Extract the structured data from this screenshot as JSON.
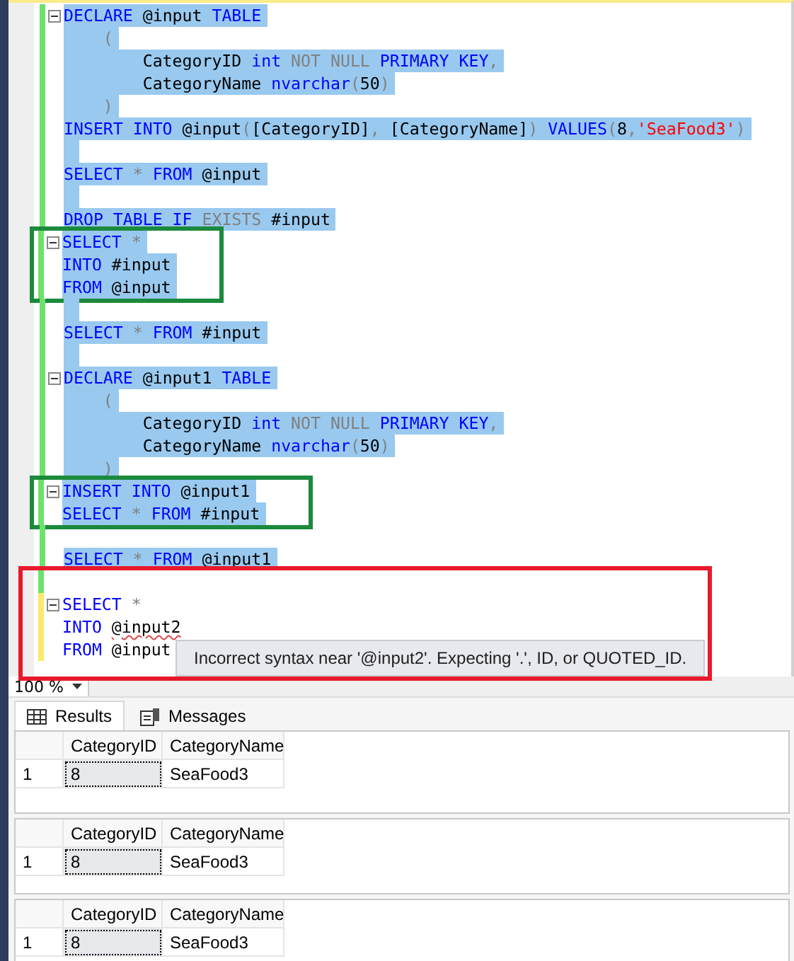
{
  "editor": {
    "blocks": [
      {
        "lines": [
          {
            "selected": true,
            "saved": true,
            "foldable": true,
            "tokens": [
              {
                "kind": "keyword",
                "text": "DECLARE"
              },
              {
                "kind": "plain",
                "text": " @input "
              },
              {
                "kind": "keyword",
                "text": "TABLE"
              }
            ]
          },
          {
            "selected": true,
            "saved": true,
            "foldable": false,
            "tokens": [
              {
                "kind": "operator",
                "text": "    ("
              }
            ]
          },
          {
            "selected": true,
            "saved": true,
            "foldable": false,
            "tokens": [
              {
                "kind": "plain",
                "text": "        CategoryID "
              },
              {
                "kind": "keyword",
                "text": "int"
              },
              {
                "kind": "operator",
                "text": " NOT NULL "
              },
              {
                "kind": "keyword",
                "text": "PRIMARY KEY"
              },
              {
                "kind": "operator",
                "text": ","
              }
            ]
          },
          {
            "selected": true,
            "saved": true,
            "foldable": false,
            "tokens": [
              {
                "kind": "plain",
                "text": "        CategoryName "
              },
              {
                "kind": "keyword",
                "text": "nvarchar"
              },
              {
                "kind": "operator",
                "text": "("
              },
              {
                "kind": "plain",
                "text": "50"
              },
              {
                "kind": "operator",
                "text": ")"
              }
            ]
          },
          {
            "selected": true,
            "saved": true,
            "foldable": false,
            "tokens": [
              {
                "kind": "operator",
                "text": "    )"
              }
            ]
          },
          {
            "selected": true,
            "saved": true,
            "foldable": false,
            "tokens": [
              {
                "kind": "keyword",
                "text": "INSERT INTO"
              },
              {
                "kind": "plain",
                "text": " @input"
              },
              {
                "kind": "operator",
                "text": "("
              },
              {
                "kind": "plain",
                "text": "[CategoryID]"
              },
              {
                "kind": "operator",
                "text": ", "
              },
              {
                "kind": "plain",
                "text": "[CategoryName]"
              },
              {
                "kind": "operator",
                "text": ") "
              },
              {
                "kind": "keyword",
                "text": "VALUES"
              },
              {
                "kind": "operator",
                "text": "("
              },
              {
                "kind": "plain",
                "text": "8"
              },
              {
                "kind": "operator",
                "text": ","
              },
              {
                "kind": "string",
                "text": "'SeaFood3'"
              },
              {
                "kind": "operator",
                "text": ")"
              }
            ]
          },
          {
            "selected": true,
            "saved": true,
            "foldable": false
          },
          {
            "selected": true,
            "saved": true,
            "foldable": false,
            "tokens": [
              {
                "kind": "keyword",
                "text": "SELECT"
              },
              {
                "kind": "operator",
                "text": " * "
              },
              {
                "kind": "keyword",
                "text": "FROM"
              },
              {
                "kind": "plain",
                "text": " @input"
              }
            ]
          },
          {
            "selected": true,
            "saved": true,
            "foldable": false
          },
          {
            "selected": true,
            "saved": true,
            "foldable": false,
            "tokens": [
              {
                "kind": "keyword",
                "text": "DROP TABLE IF"
              },
              {
                "kind": "operator",
                "text": " EXISTS "
              },
              {
                "kind": "plain",
                "text": "#input"
              }
            ]
          }
        ]
      },
      {
        "color": "#1b8a3c",
        "lines": [
          {
            "selected": true,
            "saved": true,
            "foldable": true,
            "tokens": [
              {
                "kind": "keyword",
                "text": "SELECT"
              },
              {
                "kind": "operator",
                "text": " *"
              }
            ]
          },
          {
            "selected": true,
            "saved": true,
            "foldable": false,
            "tokens": [
              {
                "kind": "keyword",
                "text": "INTO"
              },
              {
                "kind": "plain",
                "text": " #input"
              }
            ]
          },
          {
            "selected": true,
            "saved": true,
            "foldable": false,
            "tokens": [
              {
                "kind": "keyword",
                "text": "FROM"
              },
              {
                "kind": "plain",
                "text": " @input"
              }
            ]
          }
        ]
      },
      {
        "lines": [
          {
            "selected": true,
            "saved": true,
            "foldable": false
          },
          {
            "selected": true,
            "saved": true,
            "foldable": false,
            "tokens": [
              {
                "kind": "keyword",
                "text": "SELECT"
              },
              {
                "kind": "operator",
                "text": " * "
              },
              {
                "kind": "keyword",
                "text": "FROM"
              },
              {
                "kind": "plain",
                "text": " #input"
              }
            ]
          },
          {
            "selected": true,
            "saved": true,
            "foldable": false
          },
          {
            "selected": true,
            "saved": true,
            "foldable": true,
            "tokens": [
              {
                "kind": "keyword",
                "text": "DECLARE"
              },
              {
                "kind": "plain",
                "text": " @input1 "
              },
              {
                "kind": "keyword",
                "text": "TABLE"
              }
            ]
          },
          {
            "selected": true,
            "saved": true,
            "foldable": false,
            "tokens": [
              {
                "kind": "operator",
                "text": "    ("
              }
            ]
          },
          {
            "selected": true,
            "saved": true,
            "foldable": false,
            "tokens": [
              {
                "kind": "plain",
                "text": "        CategoryID "
              },
              {
                "kind": "keyword",
                "text": "int"
              },
              {
                "kind": "operator",
                "text": " NOT NULL "
              },
              {
                "kind": "keyword",
                "text": "PRIMARY KEY"
              },
              {
                "kind": "operator",
                "text": ","
              }
            ]
          },
          {
            "selected": true,
            "saved": true,
            "foldable": false,
            "tokens": [
              {
                "kind": "plain",
                "text": "        CategoryName "
              },
              {
                "kind": "keyword",
                "text": "nvarchar"
              },
              {
                "kind": "operator",
                "text": "("
              },
              {
                "kind": "plain",
                "text": "50"
              },
              {
                "kind": "operator",
                "text": ")"
              }
            ]
          },
          {
            "selected": true,
            "saved": true,
            "foldable": false,
            "tokens": [
              {
                "kind": "operator",
                "text": "    )"
              }
            ]
          }
        ]
      },
      {
        "color": "#1b8a3c",
        "lines": [
          {
            "selected": true,
            "saved": true,
            "foldable": true,
            "tokens": [
              {
                "kind": "keyword",
                "text": "INSERT INTO"
              },
              {
                "kind": "plain",
                "text": " @input1"
              }
            ]
          },
          {
            "selected": true,
            "saved": true,
            "foldable": false,
            "tokens": [
              {
                "kind": "keyword",
                "text": "SELECT"
              },
              {
                "kind": "operator",
                "text": " * "
              },
              {
                "kind": "keyword",
                "text": "FROM"
              },
              {
                "kind": "plain",
                "text": " #input"
              }
            ]
          }
        ]
      },
      {
        "lines": [
          {
            "selected": false,
            "saved": true,
            "foldable": false
          },
          {
            "selected": true,
            "saved": true,
            "foldable": false,
            "tokens": [
              {
                "kind": "keyword",
                "text": "SELECT"
              },
              {
                "kind": "operator",
                "text": " * "
              },
              {
                "kind": "keyword",
                "text": "FROM"
              },
              {
                "kind": "plain",
                "text": " @input1"
              }
            ]
          }
        ]
      },
      {
        "color": "#e8192c",
        "tooltip": "Incorrect syntax near '@input2'.  Expecting '.', ID, or QUOTED_ID.",
        "lines": [
          {
            "selected": false,
            "saved": true,
            "foldable": false
          },
          {
            "selected": false,
            "saved": false,
            "foldable": true,
            "tokens": [
              {
                "kind": "keyword",
                "text": "SELECT"
              },
              {
                "kind": "operator",
                "text": " *"
              }
            ]
          },
          {
            "selected": false,
            "saved": false,
            "foldable": false,
            "tokens": [
              {
                "kind": "keyword",
                "text": "INTO "
              },
              {
                "kind": "error",
                "text": "@input2"
              }
            ]
          },
          {
            "selected": false,
            "saved": false,
            "foldable": false,
            "tokens": [
              {
                "kind": "keyword",
                "text": "FROM"
              },
              {
                "kind": "plain",
                "text": " @input"
              }
            ]
          }
        ]
      }
    ]
  },
  "zoom": "100 %",
  "results": {
    "tabs": [
      {
        "label": "Results",
        "kind": "grid",
        "selected": true
      },
      {
        "label": "Messages",
        "kind": "messages",
        "selected": false
      }
    ],
    "grids": [
      {
        "columns": [
          "CategoryID",
          "CategoryName"
        ],
        "rows": [
          {
            "number": "1",
            "cells": [
              {
                "text": "8",
                "selected": true
              },
              {
                "text": "SeaFood3",
                "selected": false
              }
            ]
          }
        ]
      },
      {
        "columns": [
          "CategoryID",
          "CategoryName"
        ],
        "rows": [
          {
            "number": "1",
            "cells": [
              {
                "text": "8",
                "selected": true
              },
              {
                "text": "SeaFood3",
                "selected": false
              }
            ]
          }
        ]
      },
      {
        "columns": [
          "CategoryID",
          "CategoryName"
        ],
        "rows": [
          {
            "number": "1",
            "cells": [
              {
                "text": "8",
                "selected": true
              },
              {
                "text": "SeaFood3",
                "selected": false
              }
            ]
          }
        ]
      }
    ]
  }
}
